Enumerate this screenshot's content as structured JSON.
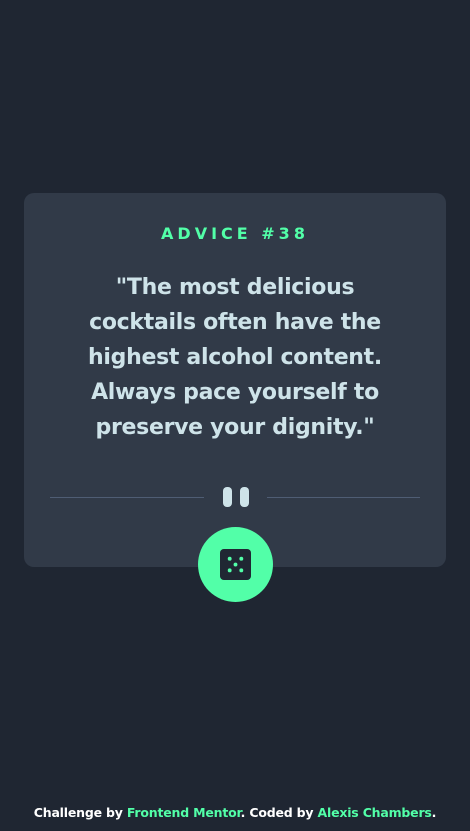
{
  "advice": {
    "label": "ADVICE #38",
    "quote": "\"The most delicious cocktails often have the highest alcohol content. Always pace yourself to preserve your dignity.\""
  },
  "icons": {
    "divider": "pause-icon",
    "button": "dice-icon"
  },
  "footer": {
    "challenge_prefix": "Challenge by ",
    "challenge_link": "Frontend Mentor",
    "coded_prefix": ". Coded by ",
    "coded_link": "Alexis Chambers",
    "suffix": "."
  },
  "colors": {
    "background": "#1f2632",
    "card": "#313a48",
    "accent": "#52ffa8",
    "text": "#cee3e9"
  }
}
